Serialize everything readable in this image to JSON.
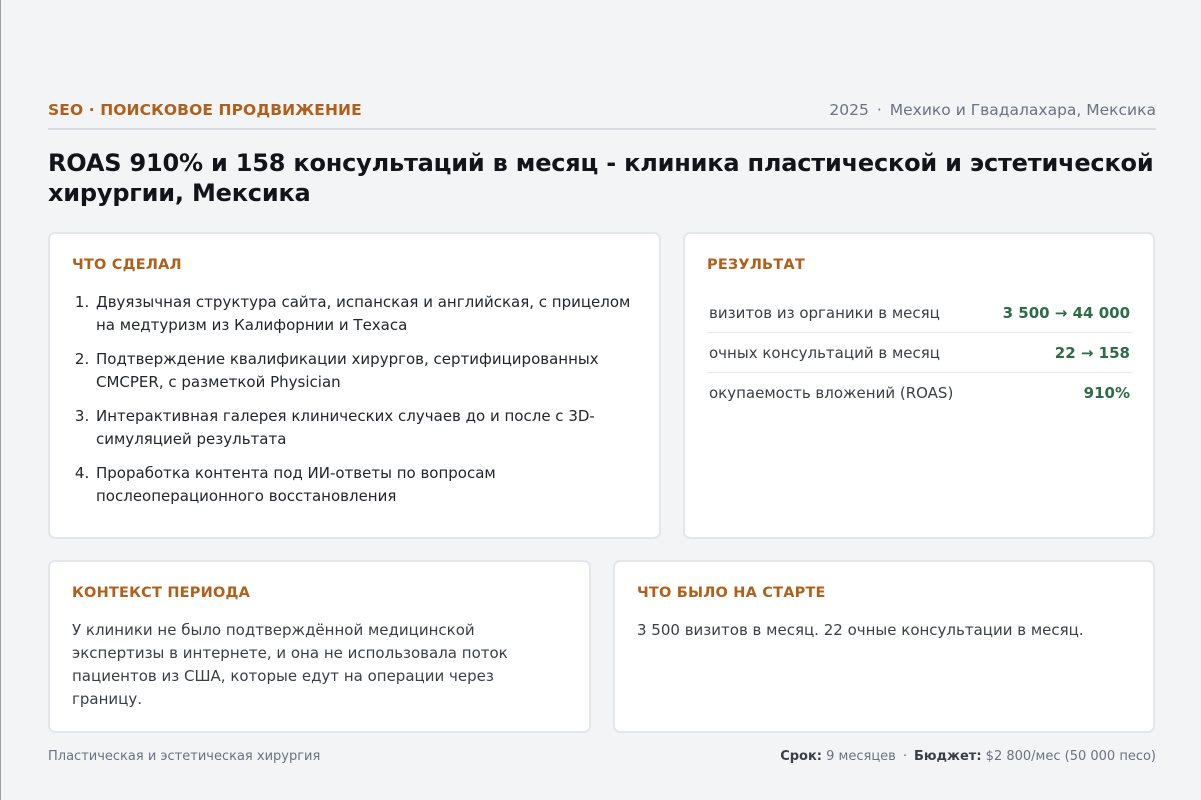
{
  "header": {
    "eyebrow": "SEO · ПОИСКОВОЕ ПРОДВИЖЕНИЕ",
    "year": "2025",
    "location": "Мехико и Гвадалахара, Мексика"
  },
  "title": "ROAS 910% и 158 консультаций в месяц - клиника пластической и эстетической хирургии, Мексика",
  "did": {
    "title": "ЧТО СДЕЛАЛ",
    "steps": [
      "Двуязычная структура сайта, испанская и английская, с прицелом на медтуризм из Калифорнии и Техаса",
      "Подтверждение квалификации хирургов, сертифицированных CMCPER, с разметкой Physician",
      "Интерактивная галерея клинических случаев до и после с 3D-симуляцией результата",
      "Проработка контента под ИИ-ответы по вопросам послеоперационного восстановления"
    ]
  },
  "result": {
    "title": "РЕЗУЛЬТАТ",
    "metrics": [
      {
        "label": "визитов из органики в месяц",
        "value": "3 500 → 44 000"
      },
      {
        "label": "очных консультаций в месяц",
        "value": "22 → 158"
      },
      {
        "label": "окупаемость вложений (ROAS)",
        "value": "910%"
      }
    ]
  },
  "context": {
    "title": "КОНТЕКСТ ПЕРИОДА",
    "text": "У клиники не было подтверждённой медицинской экспертизы в интернете, и она не использовала поток пациентов из США, которые едут на операции через границу."
  },
  "start": {
    "title": "ЧТО БЫЛО НА СТАРТЕ",
    "text": "3 500 визитов в месяц. 22 очные консультации в месяц."
  },
  "footer": {
    "category": "Пластическая и эстетическая хирургия",
    "term_label": "Срок:",
    "term_value": "9 месяцев",
    "budget_label": "Бюджет:",
    "budget_value": "$2 800/мес (50 000 песо)"
  },
  "colors": {
    "accent": "#b0601b",
    "positive": "#2e6b47",
    "background": "#f3f4f6"
  }
}
